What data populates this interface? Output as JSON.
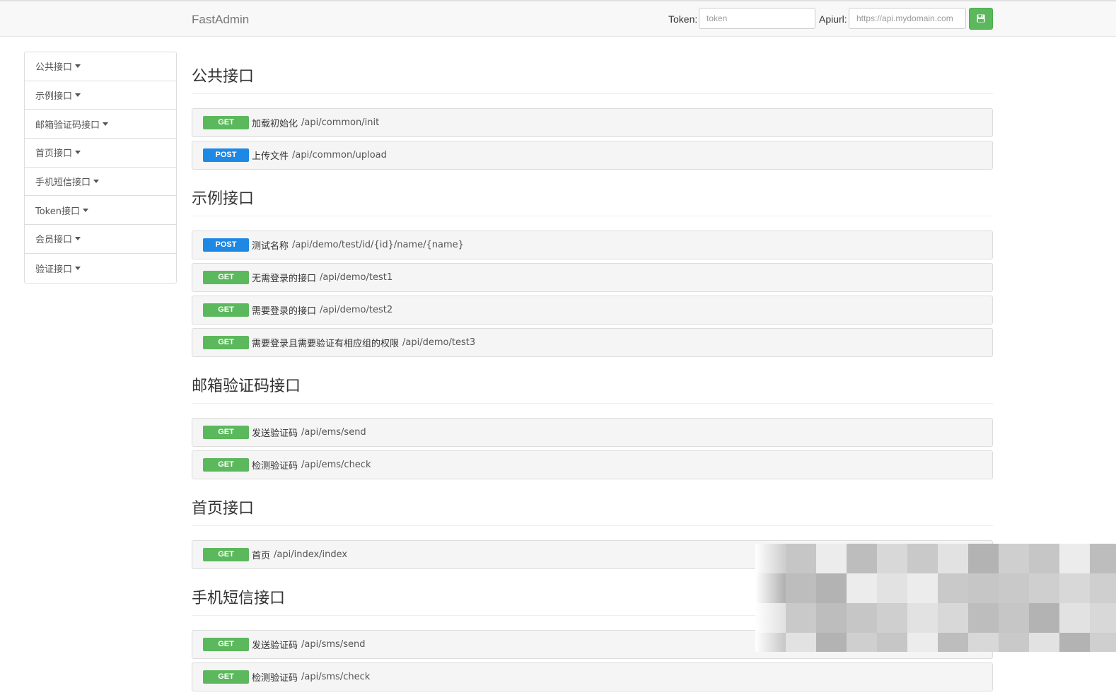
{
  "navbar": {
    "brand": "FastAdmin",
    "token_label": "Token:",
    "token_placeholder": "token",
    "apiurl_label": "Apiurl:",
    "apiurl_placeholder": "https://api.mydomain.com",
    "save_icon": "floppy-disk-icon",
    "accent": "#5cb85c"
  },
  "sidebar": {
    "items": [
      {
        "label": "公共接口"
      },
      {
        "label": "示例接口"
      },
      {
        "label": "邮箱验证码接口"
      },
      {
        "label": "首页接口"
      },
      {
        "label": "手机短信接口"
      },
      {
        "label": "Token接口"
      },
      {
        "label": "会员接口"
      },
      {
        "label": "验证接口"
      }
    ]
  },
  "colors": {
    "get": "#5cb85c",
    "post": "#1e88e5"
  },
  "sections": [
    {
      "title": "公共接口",
      "apis": [
        {
          "method": "GET",
          "title": "加载初始化",
          "path": "/api/common/init"
        },
        {
          "method": "POST",
          "title": "上传文件",
          "path": "/api/common/upload"
        }
      ]
    },
    {
      "title": "示例接口",
      "apis": [
        {
          "method": "POST",
          "title": "测试名称",
          "path": "/api/demo/test/id/{id}/name/{name}"
        },
        {
          "method": "GET",
          "title": "无需登录的接口",
          "path": "/api/demo/test1"
        },
        {
          "method": "GET",
          "title": "需要登录的接口",
          "path": "/api/demo/test2"
        },
        {
          "method": "GET",
          "title": "需要登录且需要验证有相应组的权限",
          "path": "/api/demo/test3"
        }
      ]
    },
    {
      "title": "邮箱验证码接口",
      "apis": [
        {
          "method": "GET",
          "title": "发送验证码",
          "path": "/api/ems/send"
        },
        {
          "method": "GET",
          "title": "检测验证码",
          "path": "/api/ems/check"
        }
      ]
    },
    {
      "title": "首页接口",
      "apis": [
        {
          "method": "GET",
          "title": "首页",
          "path": "/api/index/index"
        }
      ]
    },
    {
      "title": "手机短信接口",
      "apis": [
        {
          "method": "GET",
          "title": "发送验证码",
          "path": "/api/sms/send"
        },
        {
          "method": "GET",
          "title": "检测验证码",
          "path": "/api/sms/check"
        }
      ]
    }
  ]
}
